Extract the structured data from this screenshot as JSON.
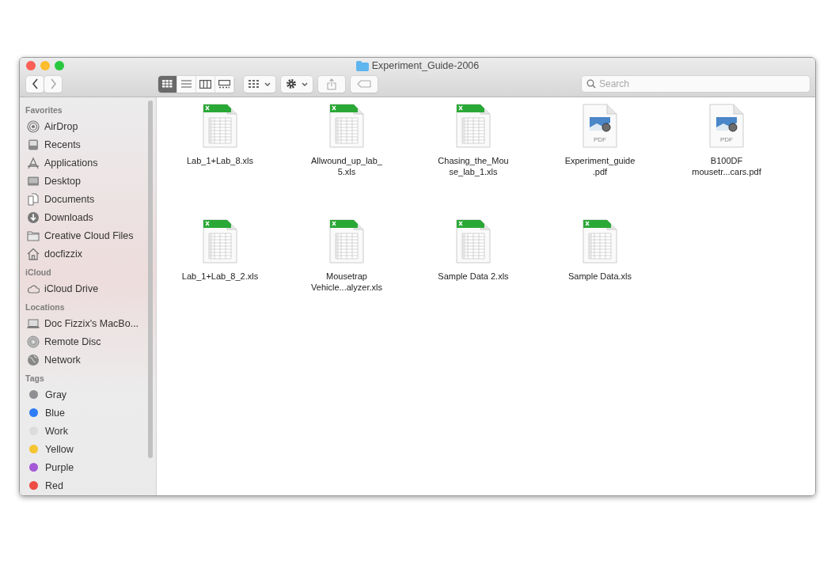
{
  "window": {
    "title": "Experiment_Guide-2006"
  },
  "toolbar": {
    "view_modes": [
      {
        "kind": "icons",
        "selected": true
      },
      {
        "kind": "list",
        "selected": false
      },
      {
        "kind": "columns",
        "selected": false
      },
      {
        "kind": "gallery",
        "selected": false
      }
    ],
    "search": {
      "placeholder": "Search"
    }
  },
  "sidebar": {
    "sections": [
      {
        "title": "Favorites",
        "items": [
          {
            "label": "AirDrop",
            "kind": "airdrop"
          },
          {
            "label": "Recents",
            "kind": "recents"
          },
          {
            "label": "Applications",
            "kind": "apps"
          },
          {
            "label": "Desktop",
            "kind": "desktop"
          },
          {
            "label": "Documents",
            "kind": "documents"
          },
          {
            "label": "Downloads",
            "kind": "downloads"
          },
          {
            "label": "Creative Cloud Files",
            "kind": "folder"
          },
          {
            "label": "docfizzix",
            "kind": "home"
          }
        ]
      },
      {
        "title": "iCloud",
        "items": [
          {
            "label": "iCloud Drive",
            "kind": "cloud"
          }
        ]
      },
      {
        "title": "Locations",
        "items": [
          {
            "label": "Doc Fizzix's MacBo...",
            "kind": "laptop"
          },
          {
            "label": "Remote Disc",
            "kind": "disc"
          },
          {
            "label": "Network",
            "kind": "globe"
          }
        ]
      },
      {
        "title": "Tags",
        "items": [
          {
            "label": "Gray",
            "kind": "tag",
            "color": "#8e8e93"
          },
          {
            "label": "Blue",
            "kind": "tag",
            "color": "#2f7cf6"
          },
          {
            "label": "Work",
            "kind": "tag",
            "color": "#dcdcdc"
          },
          {
            "label": "Yellow",
            "kind": "tag",
            "color": "#f5c431"
          },
          {
            "label": "Purple",
            "kind": "tag",
            "color": "#a55ad8"
          },
          {
            "label": "Red",
            "kind": "tag",
            "color": "#ee4b45"
          }
        ]
      }
    ]
  },
  "files": [
    {
      "name": "Lab_1+Lab_8.xls",
      "kind": "xls"
    },
    {
      "name": "Allwound_up_lab_\n5.xls",
      "kind": "xls"
    },
    {
      "name": "Chasing_the_Mou\nse_lab_1.xls",
      "kind": "xls"
    },
    {
      "name": "Experiment_guide\n.pdf",
      "kind": "pdf",
      "badge": "PDF"
    },
    {
      "name": "B100DF\nmousetr...cars.pdf",
      "kind": "pdf",
      "badge": "PDF"
    },
    {
      "name": "Lab_1+Lab_8_2.xls",
      "kind": "xls"
    },
    {
      "name": "Mousetrap\nVehicle...alyzer.xls",
      "kind": "xls"
    },
    {
      "name": "Sample Data 2.xls",
      "kind": "xls"
    },
    {
      "name": "Sample Data.xls",
      "kind": "xls"
    }
  ]
}
